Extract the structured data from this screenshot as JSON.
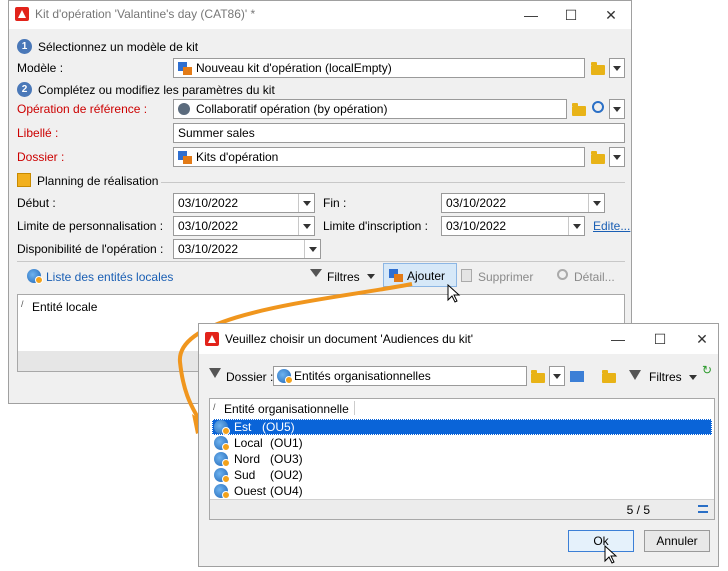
{
  "main_window": {
    "title": "Kit d'opération 'Valantine's day  (CAT86)' *",
    "minimize": "—",
    "maximize": "☐",
    "close": "✕",
    "step1": {
      "number": "1",
      "label": "Sélectionnez un modèle de kit"
    },
    "modele": {
      "label": "Modèle :",
      "value": "Nouveau kit d'opération (localEmpty)"
    },
    "step2": {
      "number": "2",
      "label": "Complétez ou modifiez les paramètres du kit"
    },
    "operation_ref": {
      "label": "Opération de référence :",
      "value": "Collaboratif opération  (by opération)"
    },
    "libelle": {
      "label": "Libellé :",
      "value": "Summer sales"
    },
    "dossier": {
      "label": "Dossier :",
      "value": "Kits d'opération"
    },
    "planning": {
      "label": "Planning de réalisation"
    },
    "debut": {
      "label": "Début :",
      "value": "03/10/2022"
    },
    "fin": {
      "label": "Fin :",
      "value": "03/10/2022"
    },
    "limite_perso": {
      "label": "Limite de personnalisation :",
      "value": "03/10/2022"
    },
    "limite_inscr": {
      "label": "Limite d'inscription :",
      "value": "03/10/2022"
    },
    "edit_link": "Edite...",
    "dispo": {
      "label": "Disponibilité de l'opération :",
      "value": "03/10/2022"
    },
    "entities_toolbar": {
      "list_label": "Liste des entités locales",
      "filtres": "Filtres",
      "ajouter": "Ajouter",
      "supprimer": "Supprimer",
      "detail": "Détail..."
    },
    "entities_grid": {
      "column": "Entité locale"
    }
  },
  "dialog": {
    "title": "Veuillez choisir un document 'Audiences du kit'",
    "minimize": "—",
    "maximize": "☐",
    "close": "✕",
    "dossier_label": "Dossier :",
    "dossier_value": "Entités organisationnelles",
    "filtres": "Filtres",
    "column": "Entité organisationnelle",
    "rows": [
      {
        "name": "Est",
        "code": "(OU5)"
      },
      {
        "name": "Local",
        "code": "(OU1)"
      },
      {
        "name": "Nord",
        "code": "(OU3)"
      },
      {
        "name": "Sud",
        "code": "(OU2)"
      },
      {
        "name": "Ouest",
        "code": "(OU4)"
      }
    ],
    "count": "5 / 5",
    "ok": "Ok",
    "annuler": "Annuler"
  },
  "colors": {
    "accent": "#f0961e",
    "selection": "#0a64d8",
    "required": "#cc0000",
    "link": "#1a5fb4"
  }
}
